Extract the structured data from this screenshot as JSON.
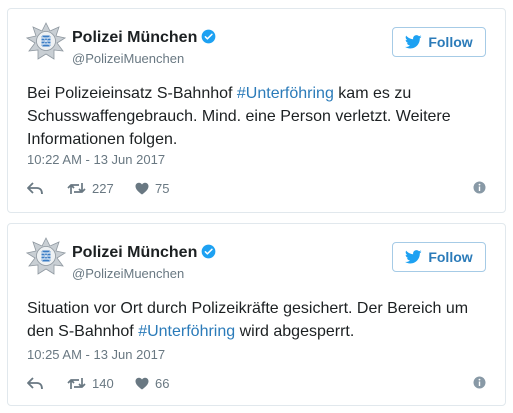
{
  "tweets": [
    {
      "name": "Polizei München",
      "handle": "@PolizeiMuenchen",
      "follow_label": "Follow",
      "text_before": "Bei Polizeieinsatz S-Bahnhof ",
      "hashtag": "#Unterföhring",
      "text_after": " kam es zu Schusswaffengebrauch. Mind. eine Person verletzt. Weitere Informationen folgen.",
      "timestamp": "10:22 AM - 13 Jun 2017",
      "retweets": "227",
      "likes": "75"
    },
    {
      "name": "Polizei München",
      "handle": "@PolizeiMuenchen",
      "follow_label": "Follow",
      "text_before": "Situation vor Ort durch Polizeikräfte gesichert. Der Bereich um den S-Bahnhof ",
      "hashtag": "#Unterföhring",
      "text_after": " wird abgesperrt.",
      "timestamp": "10:25 AM - 13 Jun 2017",
      "retweets": "140",
      "likes": "66"
    }
  ],
  "colors": {
    "link": "#2b7bb9",
    "muted": "#697882",
    "verified": "#1da1f2",
    "border": "#e1e8ed"
  },
  "icons": [
    "police-star-avatar",
    "verified-icon",
    "twitter-bird-icon",
    "reply-icon",
    "retweet-icon",
    "heart-icon",
    "info-icon"
  ]
}
